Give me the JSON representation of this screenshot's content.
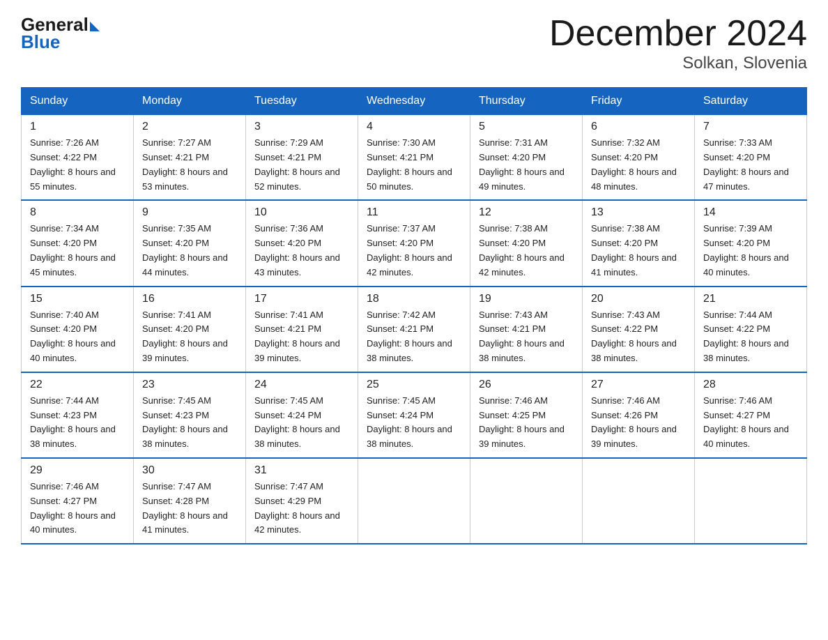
{
  "logo": {
    "general": "General",
    "blue": "Blue"
  },
  "title": "December 2024",
  "subtitle": "Solkan, Slovenia",
  "days_of_week": [
    "Sunday",
    "Monday",
    "Tuesday",
    "Wednesday",
    "Thursday",
    "Friday",
    "Saturday"
  ],
  "weeks": [
    [
      {
        "day": "1",
        "sunrise": "7:26 AM",
        "sunset": "4:22 PM",
        "daylight": "8 hours and 55 minutes."
      },
      {
        "day": "2",
        "sunrise": "7:27 AM",
        "sunset": "4:21 PM",
        "daylight": "8 hours and 53 minutes."
      },
      {
        "day": "3",
        "sunrise": "7:29 AM",
        "sunset": "4:21 PM",
        "daylight": "8 hours and 52 minutes."
      },
      {
        "day": "4",
        "sunrise": "7:30 AM",
        "sunset": "4:21 PM",
        "daylight": "8 hours and 50 minutes."
      },
      {
        "day": "5",
        "sunrise": "7:31 AM",
        "sunset": "4:20 PM",
        "daylight": "8 hours and 49 minutes."
      },
      {
        "day": "6",
        "sunrise": "7:32 AM",
        "sunset": "4:20 PM",
        "daylight": "8 hours and 48 minutes."
      },
      {
        "day": "7",
        "sunrise": "7:33 AM",
        "sunset": "4:20 PM",
        "daylight": "8 hours and 47 minutes."
      }
    ],
    [
      {
        "day": "8",
        "sunrise": "7:34 AM",
        "sunset": "4:20 PM",
        "daylight": "8 hours and 45 minutes."
      },
      {
        "day": "9",
        "sunrise": "7:35 AM",
        "sunset": "4:20 PM",
        "daylight": "8 hours and 44 minutes."
      },
      {
        "day": "10",
        "sunrise": "7:36 AM",
        "sunset": "4:20 PM",
        "daylight": "8 hours and 43 minutes."
      },
      {
        "day": "11",
        "sunrise": "7:37 AM",
        "sunset": "4:20 PM",
        "daylight": "8 hours and 42 minutes."
      },
      {
        "day": "12",
        "sunrise": "7:38 AM",
        "sunset": "4:20 PM",
        "daylight": "8 hours and 42 minutes."
      },
      {
        "day": "13",
        "sunrise": "7:38 AM",
        "sunset": "4:20 PM",
        "daylight": "8 hours and 41 minutes."
      },
      {
        "day": "14",
        "sunrise": "7:39 AM",
        "sunset": "4:20 PM",
        "daylight": "8 hours and 40 minutes."
      }
    ],
    [
      {
        "day": "15",
        "sunrise": "7:40 AM",
        "sunset": "4:20 PM",
        "daylight": "8 hours and 40 minutes."
      },
      {
        "day": "16",
        "sunrise": "7:41 AM",
        "sunset": "4:20 PM",
        "daylight": "8 hours and 39 minutes."
      },
      {
        "day": "17",
        "sunrise": "7:41 AM",
        "sunset": "4:21 PM",
        "daylight": "8 hours and 39 minutes."
      },
      {
        "day": "18",
        "sunrise": "7:42 AM",
        "sunset": "4:21 PM",
        "daylight": "8 hours and 38 minutes."
      },
      {
        "day": "19",
        "sunrise": "7:43 AM",
        "sunset": "4:21 PM",
        "daylight": "8 hours and 38 minutes."
      },
      {
        "day": "20",
        "sunrise": "7:43 AM",
        "sunset": "4:22 PM",
        "daylight": "8 hours and 38 minutes."
      },
      {
        "day": "21",
        "sunrise": "7:44 AM",
        "sunset": "4:22 PM",
        "daylight": "8 hours and 38 minutes."
      }
    ],
    [
      {
        "day": "22",
        "sunrise": "7:44 AM",
        "sunset": "4:23 PM",
        "daylight": "8 hours and 38 minutes."
      },
      {
        "day": "23",
        "sunrise": "7:45 AM",
        "sunset": "4:23 PM",
        "daylight": "8 hours and 38 minutes."
      },
      {
        "day": "24",
        "sunrise": "7:45 AM",
        "sunset": "4:24 PM",
        "daylight": "8 hours and 38 minutes."
      },
      {
        "day": "25",
        "sunrise": "7:45 AM",
        "sunset": "4:24 PM",
        "daylight": "8 hours and 38 minutes."
      },
      {
        "day": "26",
        "sunrise": "7:46 AM",
        "sunset": "4:25 PM",
        "daylight": "8 hours and 39 minutes."
      },
      {
        "day": "27",
        "sunrise": "7:46 AM",
        "sunset": "4:26 PM",
        "daylight": "8 hours and 39 minutes."
      },
      {
        "day": "28",
        "sunrise": "7:46 AM",
        "sunset": "4:27 PM",
        "daylight": "8 hours and 40 minutes."
      }
    ],
    [
      {
        "day": "29",
        "sunrise": "7:46 AM",
        "sunset": "4:27 PM",
        "daylight": "8 hours and 40 minutes."
      },
      {
        "day": "30",
        "sunrise": "7:47 AM",
        "sunset": "4:28 PM",
        "daylight": "8 hours and 41 minutes."
      },
      {
        "day": "31",
        "sunrise": "7:47 AM",
        "sunset": "4:29 PM",
        "daylight": "8 hours and 42 minutes."
      },
      null,
      null,
      null,
      null
    ]
  ],
  "colors": {
    "header_bg": "#1565c0",
    "header_border": "#1565c0",
    "row_border": "#1565c0"
  }
}
